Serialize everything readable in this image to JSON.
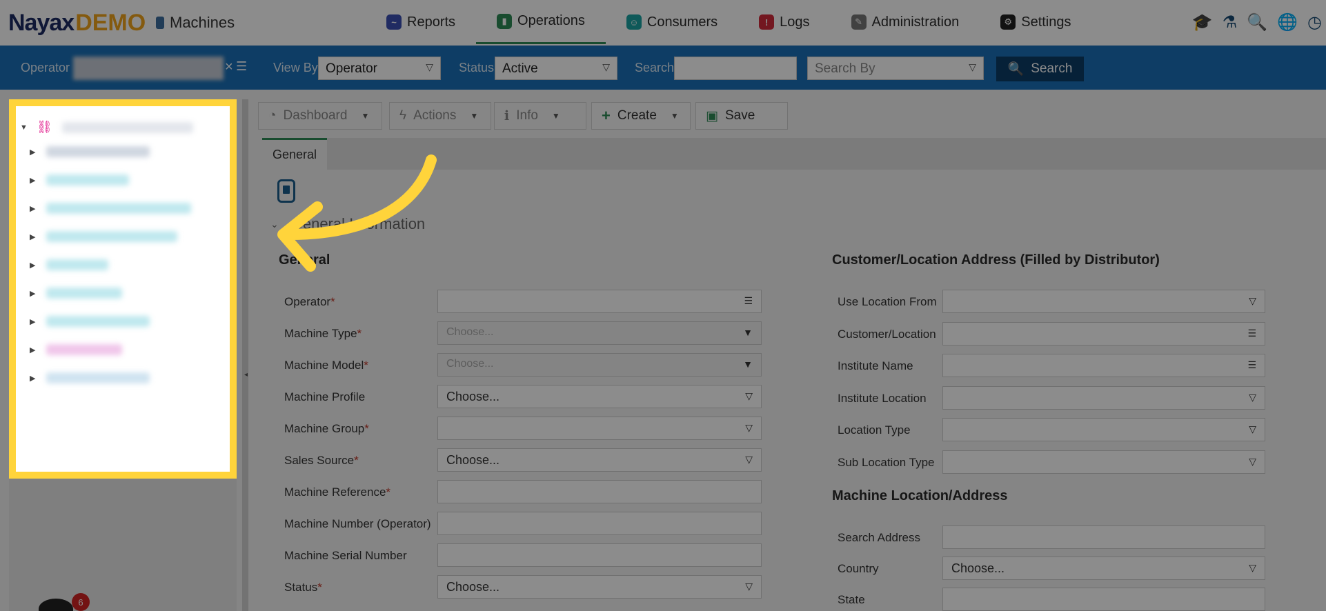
{
  "header": {
    "logo_brand": "Nayax",
    "logo_demo": "DEMO",
    "breadcrumb": "Machines",
    "nav": [
      {
        "label": "Reports",
        "color": "#3b4fb3",
        "active": false
      },
      {
        "label": "Operations",
        "color": "#2e8b57",
        "active": true
      },
      {
        "label": "Consumers",
        "color": "#1aa3a3",
        "active": false
      },
      {
        "label": "Logs",
        "color": "#d12b3b",
        "active": false
      },
      {
        "label": "Administration",
        "color": "#777777",
        "active": false
      },
      {
        "label": "Settings",
        "color": "#222222",
        "active": false
      }
    ],
    "right_icons": [
      "graduation-cap-icon",
      "flask-icon",
      "search-icon",
      "globe-icon",
      "clock-icon"
    ]
  },
  "filterbar": {
    "operator_label": "Operator",
    "viewby_label": "View By",
    "viewby_value": "Operator",
    "status_label": "Status",
    "status_value": "Active",
    "search_label": "Search",
    "search_value": "",
    "searchby_placeholder": "Search By",
    "search_button": "Search"
  },
  "toolbar": {
    "dashboard": "Dashboard",
    "actions": "Actions",
    "info": "Info",
    "create": "Create",
    "save": "Save"
  },
  "tabs": {
    "general": "General"
  },
  "section": {
    "title": "General Information"
  },
  "left_form": {
    "title": "General",
    "fields": [
      {
        "label": "Operator",
        "required": true,
        "value": "",
        "icon": "list-icon"
      },
      {
        "label": "Machine Type",
        "required": true,
        "value": "Choose...",
        "icon": "caret-down-icon",
        "disabled": true
      },
      {
        "label": "Machine Model",
        "required": true,
        "value": "Choose...",
        "icon": "caret-down-icon",
        "disabled": true
      },
      {
        "label": "Machine Profile",
        "required": false,
        "value": "Choose...",
        "icon": "dropdown-icon"
      },
      {
        "label": "Machine Group",
        "required": true,
        "value": "",
        "icon": "dropdown-icon"
      },
      {
        "label": "Sales Source",
        "required": true,
        "value": "Choose...",
        "icon": "dropdown-icon"
      },
      {
        "label": "Machine Reference",
        "required": true,
        "value": "",
        "icon": ""
      },
      {
        "label": "Machine Number (Operator)",
        "required": false,
        "value": "",
        "icon": ""
      },
      {
        "label": "Machine Serial Number",
        "required": false,
        "value": "",
        "icon": ""
      },
      {
        "label": "Status",
        "required": true,
        "value": "Choose...",
        "icon": "dropdown-icon"
      }
    ]
  },
  "right_form": {
    "title": "Customer/Location Address (Filled by Distributor)",
    "fields": [
      {
        "label": "Use Location From",
        "value": "",
        "icon": "dropdown-icon"
      },
      {
        "label": "Customer/Location",
        "value": "",
        "icon": "list-icon"
      },
      {
        "label": "Institute Name",
        "value": "",
        "icon": "list-icon"
      },
      {
        "label": "Institute Location",
        "value": "",
        "icon": "dropdown-icon"
      },
      {
        "label": "Location Type",
        "value": "",
        "icon": "dropdown-icon"
      },
      {
        "label": "Sub Location Type",
        "value": "",
        "icon": "dropdown-icon"
      }
    ],
    "title2": "Machine Location/Address",
    "fields2": [
      {
        "label": "Search Address",
        "value": "",
        "icon": ""
      },
      {
        "label": "Country",
        "value": "Choose...",
        "icon": "dropdown-icon"
      },
      {
        "label": "State",
        "value": "",
        "icon": ""
      }
    ]
  },
  "chat": {
    "badge_count": "6"
  },
  "colors": {
    "highlight": "#ffd43b",
    "filterbar": "#1a70b8",
    "accent": "#2e8b57"
  }
}
